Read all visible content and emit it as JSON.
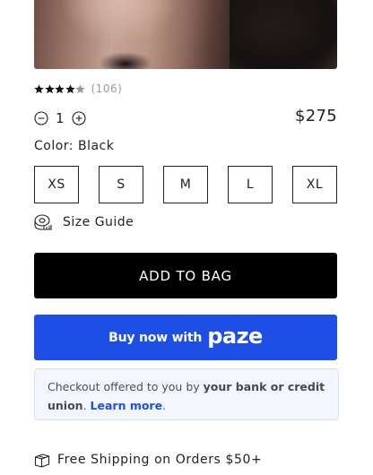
{
  "product": {
    "rating": {
      "stars_filled": 4,
      "stars_total": 5,
      "review_count": "(106)"
    },
    "quantity": {
      "value": "1"
    },
    "price": "$275",
    "color": {
      "text": "Color: Black"
    },
    "sizes": [
      "XS",
      "S",
      "M",
      "L",
      "XL"
    ],
    "size_guide_label": "Size Guide"
  },
  "buttons": {
    "add_to_bag": "ADD TO BAG",
    "paze_prefix": "Buy now with",
    "paze_logo": "paze"
  },
  "paze_info": {
    "text_1": "Checkout offered to you by ",
    "text_bold": "your bank or credit union",
    "text_2": ". ",
    "link": "Learn more",
    "text_3": "."
  },
  "shipping": {
    "label": "Free Shipping on Orders $50+"
  },
  "colors": {
    "paze_blue": "#1d4fe6",
    "button_black": "#000000",
    "star_filled": "#111111",
    "star_empty": "#9a9a9a"
  },
  "icons": {
    "minus": "minus-circle-icon",
    "plus": "plus-circle-icon",
    "size_guide": "tape-measure-icon",
    "shipping": "box-icon"
  }
}
